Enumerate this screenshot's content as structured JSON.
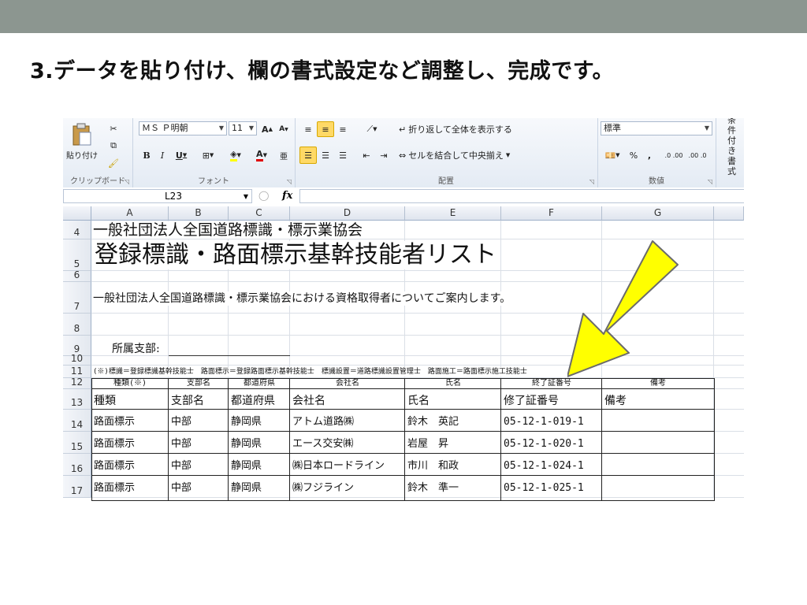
{
  "slide": {
    "title": "3.データを貼り付け、欄の書式設定など調整し、完成です。"
  },
  "ribbon": {
    "clipboard": {
      "paste_label": "貼り付け",
      "group_label": "クリップボード"
    },
    "font": {
      "font_name": "ＭＳ Ｐ明朝",
      "font_size": "11",
      "group_label": "フォント"
    },
    "alignment": {
      "wrap_label": "折り返して全体を表示する",
      "merge_label": "セルを結合して中央揃え",
      "group_label": "配置"
    },
    "number": {
      "format": "標準",
      "percent": "%",
      "comma": ",",
      "inc_decimal": ".0 .00",
      "dec_decimal": ".00 .0",
      "group_label": "数値"
    },
    "conditional": {
      "label": "条件付き書式"
    }
  },
  "formula_bar": {
    "name_box": "L23",
    "fx": "fx"
  },
  "columns": [
    "A",
    "B",
    "C",
    "D",
    "E",
    "F",
    "G"
  ],
  "rows": [
    "4",
    "5",
    "6",
    "7",
    "8",
    "9",
    "10",
    "11",
    "12",
    "13",
    "14",
    "15",
    "16",
    "17"
  ],
  "sheet": {
    "org_name": "一般社団法人全国道路標識・標示業協会",
    "list_title": "登録標識・路面標示基幹技能者リスト",
    "intro": "一般社団法人全国道路標識・標示業協会における資格取得者についてご案内します。",
    "branch_label": "所属支部:",
    "note": "(※)標識＝登録標識基幹技能士　路面標示＝登録路面標示基幹技能士　標識設置＝道路標識設置管理士　路面施工＝路面標示施工技能士",
    "header_row_small": [
      "種類(※)",
      "支部名",
      "都道府県",
      "会社名",
      "氏名",
      "終了証番号",
      "備考"
    ],
    "header_row": [
      "種類",
      "支部名",
      "都道府県",
      "会社名",
      "氏名",
      "修了証番号",
      "備考"
    ],
    "data_rows": [
      [
        "路面標示",
        "中部",
        "静岡県",
        "アトム道路㈱",
        "鈴木　英記",
        "05-12-1-019-1",
        ""
      ],
      [
        "路面標示",
        "中部",
        "静岡県",
        "エース交安㈱",
        "岩屋　昇",
        "05-12-1-020-1",
        ""
      ],
      [
        "路面標示",
        "中部",
        "静岡県",
        "㈱日本ロードライン",
        "市川　和政",
        "05-12-1-024-1",
        ""
      ],
      [
        "路面標示",
        "中部",
        "静岡県",
        "㈱フジライン",
        "鈴木　準一",
        "05-12-1-025-1",
        ""
      ]
    ]
  },
  "annotation": {
    "arrow_color": "#ffff00",
    "arrow_outline": "#6b6b6b"
  }
}
